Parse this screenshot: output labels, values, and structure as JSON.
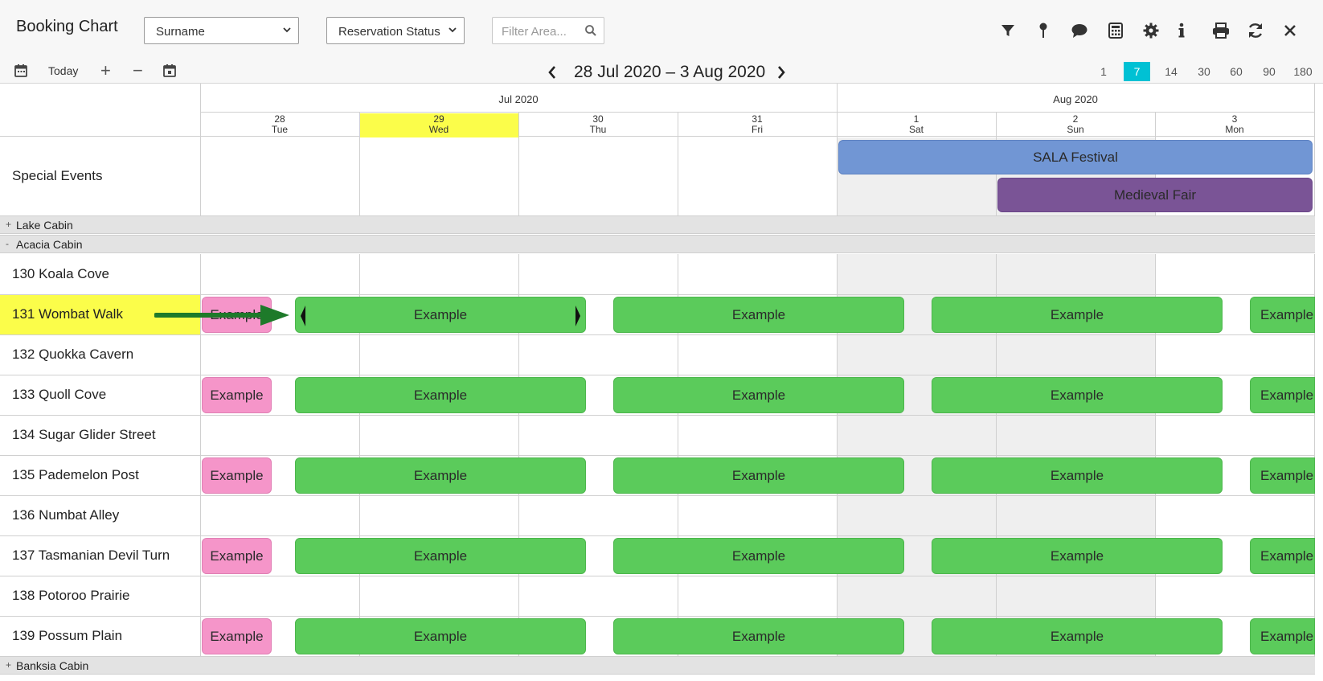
{
  "app": {
    "title": "Booking Chart"
  },
  "toolbar": {
    "surname_select": "Surname",
    "status_select": "Reservation Status",
    "filter_placeholder": "Filter Area...",
    "icons": [
      "filter-icon",
      "map-pin-icon",
      "comment-icon",
      "calculator-icon",
      "gear-icon",
      "info-icon",
      "print-icon",
      "refresh-icon",
      "close-icon"
    ]
  },
  "navbar": {
    "today_label": "Today",
    "plus_label": "+",
    "minus_label": "−",
    "date_range": "28 Jul 2020 – 3 Aug 2020",
    "zoom_options": [
      "1",
      "7",
      "14",
      "30",
      "60",
      "90",
      "180"
    ],
    "zoom_active": "7"
  },
  "header": {
    "months": [
      "Jul 2020",
      "Aug 2020"
    ],
    "days": [
      {
        "num": "28",
        "dow": "Tue"
      },
      {
        "num": "29",
        "dow": "Wed"
      },
      {
        "num": "30",
        "dow": "Thu"
      },
      {
        "num": "31",
        "dow": "Fri"
      },
      {
        "num": "1",
        "dow": "Sat"
      },
      {
        "num": "2",
        "dow": "Sun"
      },
      {
        "num": "3",
        "dow": "Mon"
      }
    ]
  },
  "special_events": {
    "label": "Special Events",
    "events": [
      {
        "name": "SALA Festival",
        "color": "#7196d4"
      },
      {
        "name": "Medieval Fair",
        "color": "#7a5496"
      }
    ]
  },
  "groups": [
    {
      "toggle": "+",
      "name": "Lake Cabin"
    },
    {
      "toggle": "-",
      "name": "Acacia Cabin"
    },
    {
      "toggle": "+",
      "name": "Banksia Cabin"
    }
  ],
  "rooms": [
    "130 Koala Cove",
    "131 Wombat Walk",
    "132 Quokka Cavern",
    "133 Quoll Cove",
    "134 Sugar Glider Street",
    "135 Pademelon Post",
    "136 Numbat Alley",
    "137 Tasmanian Devil Turn",
    "138 Potoroo Prairie",
    "139 Possum Plain"
  ],
  "booking_label": "Example",
  "colors": {
    "accent": "#00c1d4",
    "today_highlight": "#fbfd4a",
    "booking_green": "#5bcb5b",
    "booking_pink": "#f595c9",
    "arrow": "#1e7a2a"
  }
}
